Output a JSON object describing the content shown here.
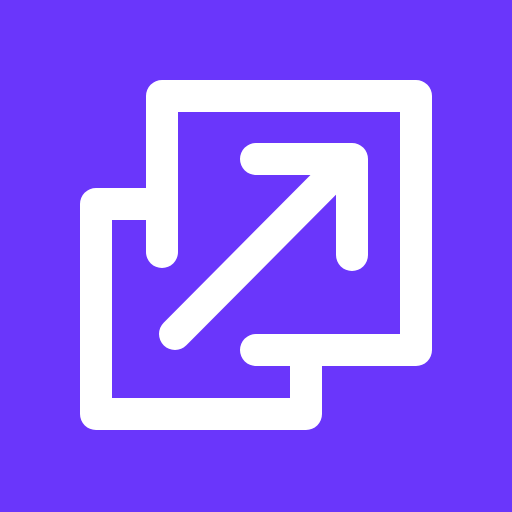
{
  "icon": {
    "name": "open-in-new-window-icon",
    "background_color": "#6A36FB",
    "foreground_color": "#FFFFFF"
  }
}
